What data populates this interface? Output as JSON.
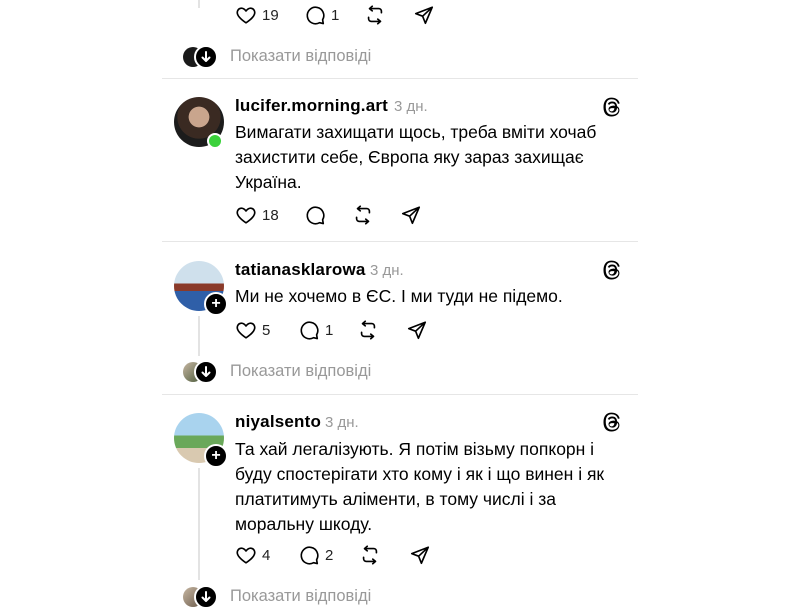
{
  "top": {
    "likes": "19",
    "replies": "1",
    "show_replies": "Показати відповіді"
  },
  "comments": [
    {
      "username": "lucifer.morning.art",
      "time": "3 дн.",
      "text": "Вимагати захищати щось, треба вміти хочаб захистити себе, Європа яку зараз захищає Україна.",
      "likes": "18",
      "replies": ""
    },
    {
      "username": "tatianasklarowa",
      "time": "3 дн.",
      "text": "Ми не хочемо в ЄС. І ми туди не підемо.",
      "likes": "5",
      "replies": "1",
      "show_replies": "Показати відповіді"
    },
    {
      "username": "niyalsento",
      "time": "3 дн.",
      "text": "Та хай легалізують. Я потім візьму попкорн і буду спостерігати хто кому і як і що винен і як платитимуть аліменти, в тому числі і за моральну шкоду.",
      "likes": "4",
      "replies": "2",
      "show_replies": "Показати відповіді"
    }
  ],
  "colors": {
    "muted": "#999999",
    "divider": "#e6e6e6",
    "online": "#3bd13b"
  }
}
